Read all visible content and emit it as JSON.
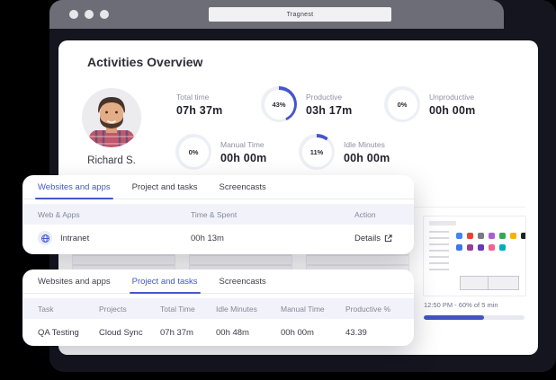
{
  "browser": {
    "address": "Tragnest"
  },
  "colors": {
    "accent": "#4556cb",
    "progress": "#4254c5",
    "donut_track": "#edeff5"
  },
  "overview": {
    "title": "Activities Overview",
    "user_name": "Richard S.",
    "stats": [
      {
        "label": "Total time",
        "value": "07h 37m"
      },
      {
        "label": "Productive",
        "value": "03h 17m",
        "percent_label": "43%",
        "percent": 43
      },
      {
        "label": "Unproductive",
        "value": "00h 00m",
        "percent_label": "0%",
        "percent": 0
      },
      {
        "label": "Manual Time",
        "value": "00h 00m",
        "percent_label": "0%",
        "percent": 0
      },
      {
        "label": "Idle Minutes",
        "value": "00h 00m",
        "percent_label": "11%",
        "percent": 11
      }
    ],
    "screencast": {
      "caption": "12:50 PM - 60% of 5 min",
      "progress": 60
    }
  },
  "tabs": [
    "Websites and apps",
    "Project and tasks",
    "Screencasts"
  ],
  "websites_card": {
    "columns": [
      "Web & Apps",
      "Time & Spent",
      "Action"
    ],
    "rows": [
      {
        "name": "Intranet",
        "time": "00h 13m",
        "action": "Details"
      }
    ]
  },
  "projects_card": {
    "columns": [
      "Task",
      "Projects",
      "Total Time",
      "Idle Minutes",
      "Manual Time",
      "Productive %"
    ],
    "rows": [
      {
        "task": "QA Testing",
        "project": "Cloud Sync",
        "total_time": "07h 37m",
        "idle": "00h 48m",
        "manual": "00h 00m",
        "productive": "43.39"
      }
    ]
  }
}
